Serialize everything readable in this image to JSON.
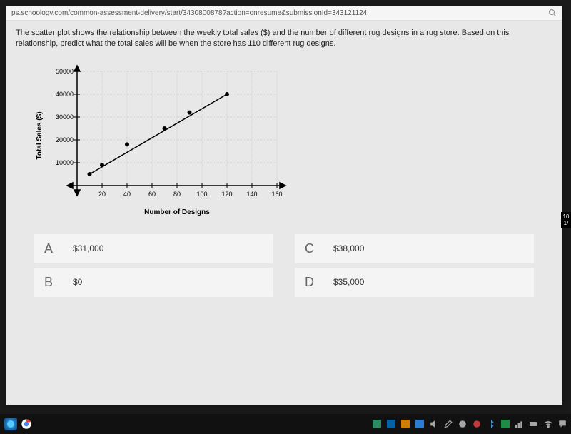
{
  "url": "ps.schoology.com/common-assessment-delivery/start/3430800878?action=onresume&submissionId=343121124",
  "question": "The scatter plot shows the relationship between the weekly total sales ($) and the number of different rug designs in a rug store. Based on this relationship, predict what the total sales will be when the store has 110 different rug designs.",
  "chart_data": {
    "type": "scatter",
    "title": "",
    "xlabel": "Number of Designs",
    "ylabel": "Total Sales ($)",
    "xlim": [
      0,
      160
    ],
    "ylim": [
      0,
      50000
    ],
    "x_ticks": [
      20,
      40,
      60,
      80,
      100,
      120,
      140,
      160
    ],
    "y_ticks": [
      10000,
      20000,
      30000,
      40000,
      50000
    ],
    "points": [
      {
        "x": 10,
        "y": 5000
      },
      {
        "x": 20,
        "y": 9000
      },
      {
        "x": 40,
        "y": 18000
      },
      {
        "x": 70,
        "y": 25000
      },
      {
        "x": 90,
        "y": 32000
      },
      {
        "x": 120,
        "y": 40000
      }
    ],
    "trend_line": {
      "x1": 10,
      "y1": 5000,
      "x2": 120,
      "y2": 40000
    }
  },
  "answers": {
    "A": {
      "letter": "A",
      "text": "$31,000"
    },
    "B": {
      "letter": "B",
      "text": "$0"
    },
    "C": {
      "letter": "C",
      "text": "$38,000"
    },
    "D": {
      "letter": "D",
      "text": "$35,000"
    }
  },
  "clock": {
    "top": "10",
    "bottom": "1/"
  }
}
